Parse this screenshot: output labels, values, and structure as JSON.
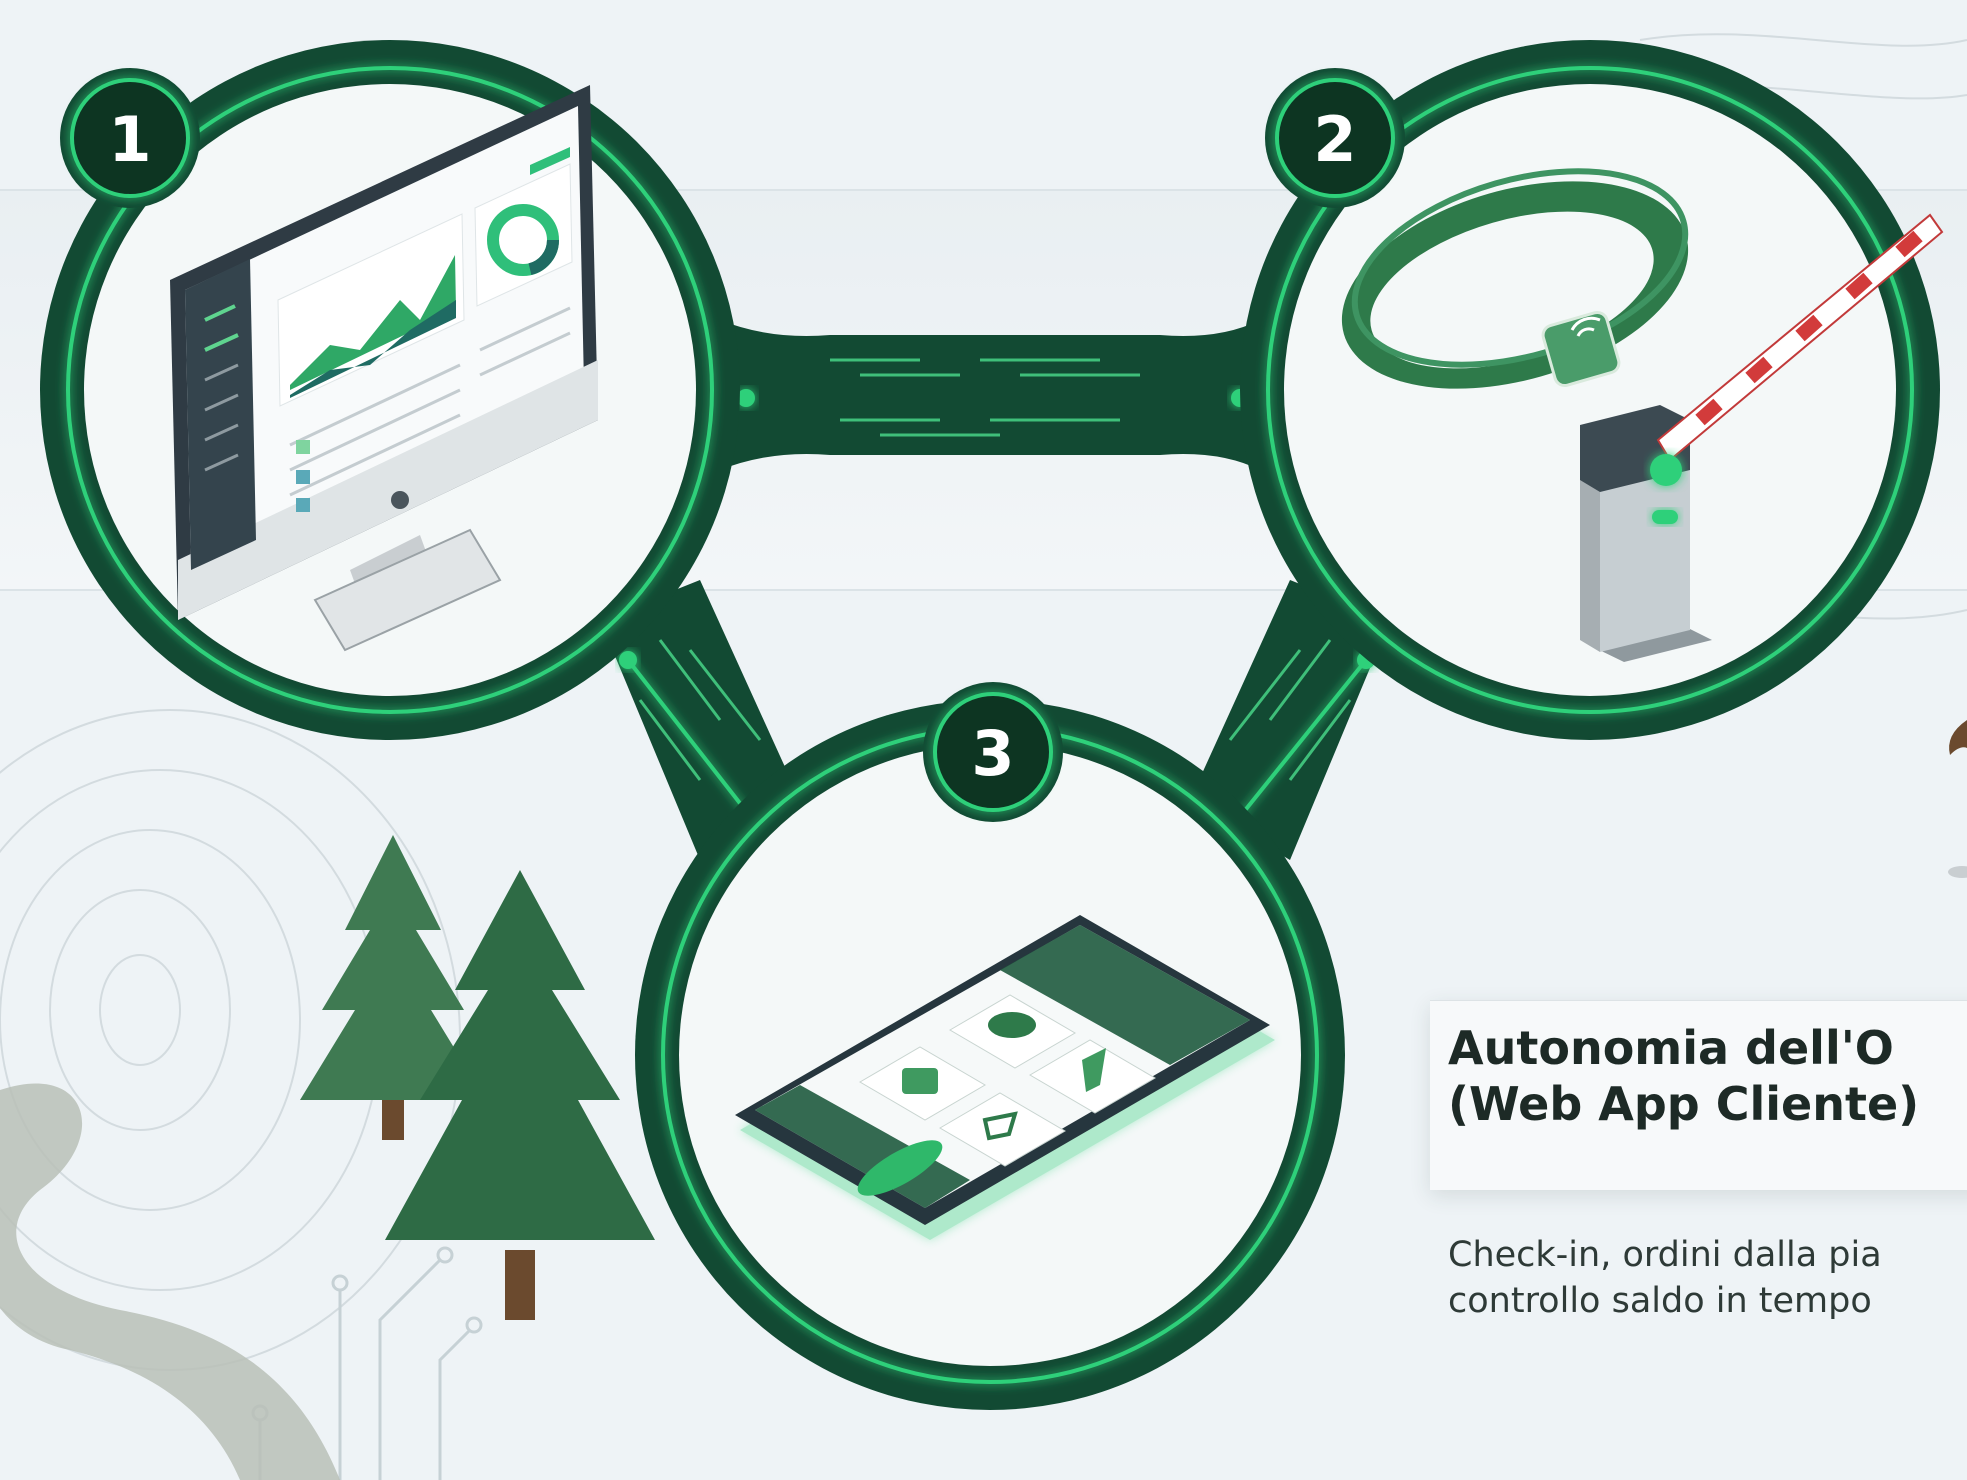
{
  "steps": [
    {
      "number": "1",
      "icon": "desktop-dashboard-icon"
    },
    {
      "number": "2",
      "icon": "rfid-wristband-barrier-icon"
    },
    {
      "number": "3",
      "icon": "smartphone-app-icon"
    }
  ],
  "card": {
    "title": "Autonomia dell'O\n(Web App Cliente)",
    "body": "Check-in, ordini dalla pia\ncontrollo saldo in tempo"
  },
  "colors": {
    "ring_dark": "#0f3d2b",
    "ring_glow": "#2fd07a",
    "tree": "#2e6b45",
    "background": "#eef3f6"
  }
}
